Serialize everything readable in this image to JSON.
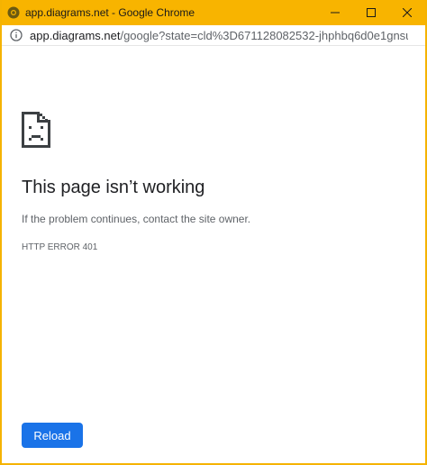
{
  "window": {
    "title": "app.diagrams.net - Google Chrome",
    "frame_color": "#f8b400"
  },
  "address_bar": {
    "host": "app.diagrams.net",
    "path": "/google?state=cld%3D671128082532-jhphbq6d0e1gnsu..."
  },
  "error_page": {
    "icon": "sad-page-icon",
    "heading": "This page isn’t working",
    "description": "If the problem continues, contact the site owner.",
    "error_code": "HTTP ERROR 401",
    "reload_label": "Reload",
    "button_color": "#1a73e8"
  },
  "icons": {
    "app": "chrome-icon",
    "info": "info-icon",
    "minimize": "minimize-icon",
    "maximize": "maximize-icon",
    "close": "close-icon"
  }
}
